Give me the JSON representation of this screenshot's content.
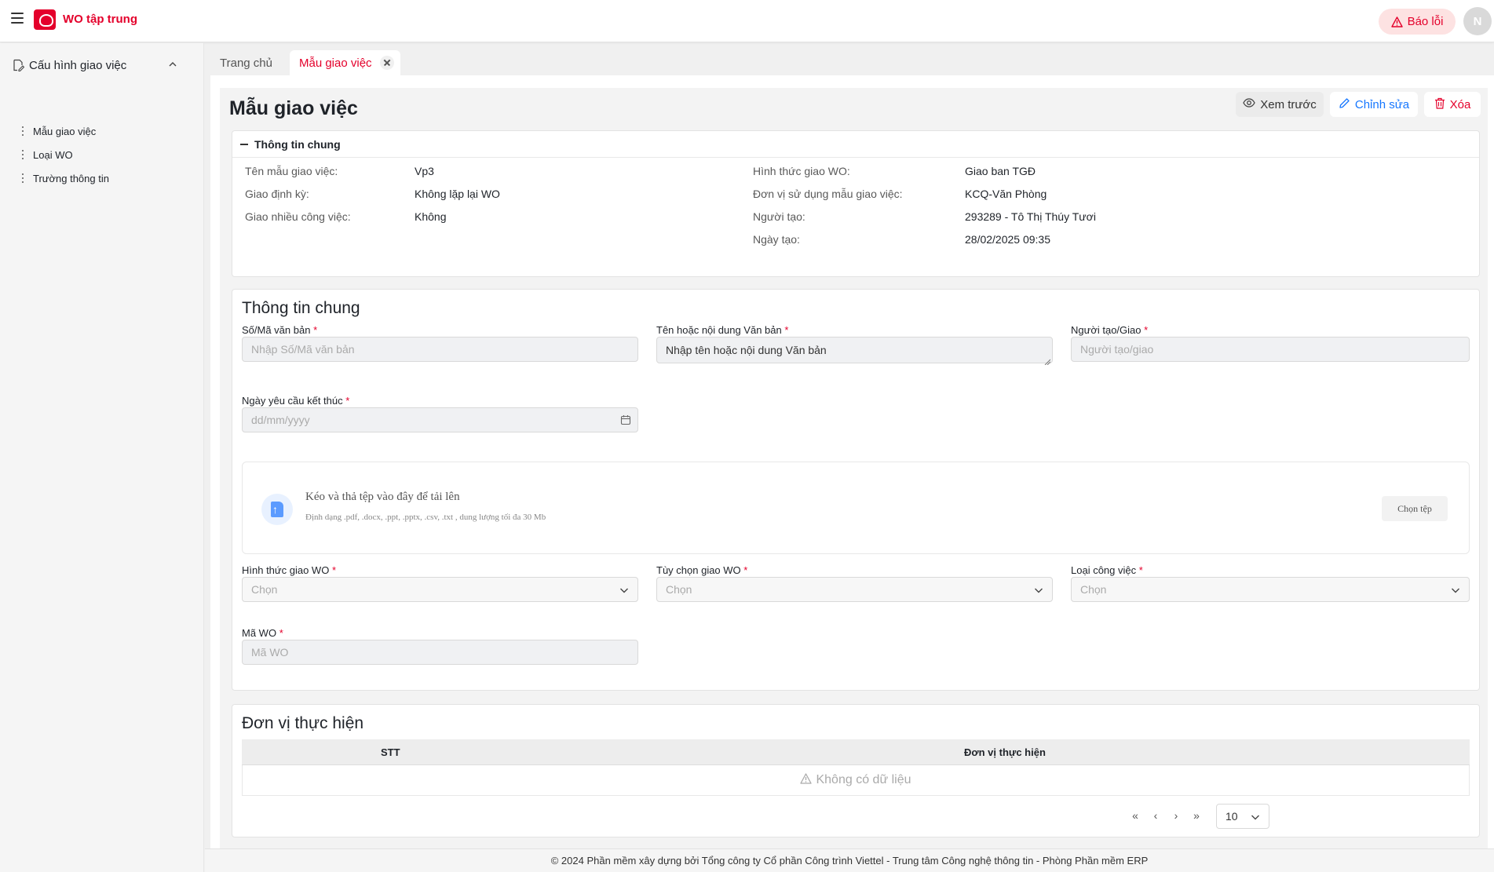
{
  "header": {
    "app_title": "WO tập trung",
    "report_label": "Báo lỗi",
    "avatar_initial": "N",
    "brand_color": "#e4002b"
  },
  "sidebar": {
    "group_label": "Cấu hình giao việc",
    "items": [
      {
        "label": "Mẫu giao việc"
      },
      {
        "label": "Loại WO"
      },
      {
        "label": "Trường thông tin"
      }
    ]
  },
  "tabs": [
    {
      "label": "Trang chủ"
    },
    {
      "label": "Mẫu giao việc",
      "active": true
    }
  ],
  "page": {
    "title": "Mẫu giao việc",
    "actions": {
      "preview": "Xem trước",
      "edit": "Chỉnh sửa",
      "delete": "Xóa"
    }
  },
  "info": {
    "section_title": "Thông tin chung",
    "left": [
      {
        "label": "Tên mẫu giao việc:",
        "value": "Vp3"
      },
      {
        "label": "Giao định kỳ:",
        "value": "Không lặp lại WO"
      },
      {
        "label": "Giao nhiều công việc:",
        "value": "Không"
      }
    ],
    "right": [
      {
        "label": "Hình thức giao WO:",
        "value": "Giao ban TGĐ"
      },
      {
        "label": "Đơn vị sử dụng mẫu giao việc:",
        "value": "KCQ-Văn Phòng"
      },
      {
        "label": "Người tạo:",
        "value": "293289 - Tô Thị Thúy Tươi"
      },
      {
        "label": "Ngày tạo:",
        "value": "28/02/2025 09:35"
      }
    ]
  },
  "form": {
    "section_title": "Thông tin chung",
    "doc_number": {
      "label": "Số/Mã văn bản",
      "placeholder": "Nhập Số/Mã văn bản"
    },
    "doc_content": {
      "label": "Tên hoặc nội dung Văn bản",
      "value": "Nhập tên hoặc nội dung Văn bản"
    },
    "creator": {
      "label": "Người tạo/Giao",
      "placeholder": "Người tạo/giao"
    },
    "due_date": {
      "label": "Ngày yêu cầu kết thúc",
      "placeholder": "dd/mm/yyyy"
    },
    "upload": {
      "title": "Kéo và thả tệp vào đây để tải lên",
      "subtitle": "Định dạng .pdf, .docx, .ppt, .pptx, .csv, .txt , dung lượng tối đa 30 Mb",
      "button": "Chọn tệp"
    },
    "wo_type": {
      "label": "Hình thức giao WO",
      "placeholder": "Chọn"
    },
    "wo_option": {
      "label": "Tùy chọn giao WO",
      "placeholder": "Chọn"
    },
    "job_type": {
      "label": "Loại công việc",
      "placeholder": "Chọn"
    },
    "wo_code": {
      "label": "Mã WO",
      "placeholder": "Mã WO"
    }
  },
  "units": {
    "section_title": "Đơn vị thực hiện",
    "columns": [
      "STT",
      "Đơn vị thực hiện"
    ],
    "empty_text": "Không có dữ liệu",
    "page_size": "10"
  },
  "footer": {
    "text": "© 2024 Phần mềm xây dựng bởi Tổng công ty Cổ phần Công trình Viettel - Trung tâm Công nghệ thông tin - Phòng Phần mềm ERP"
  }
}
